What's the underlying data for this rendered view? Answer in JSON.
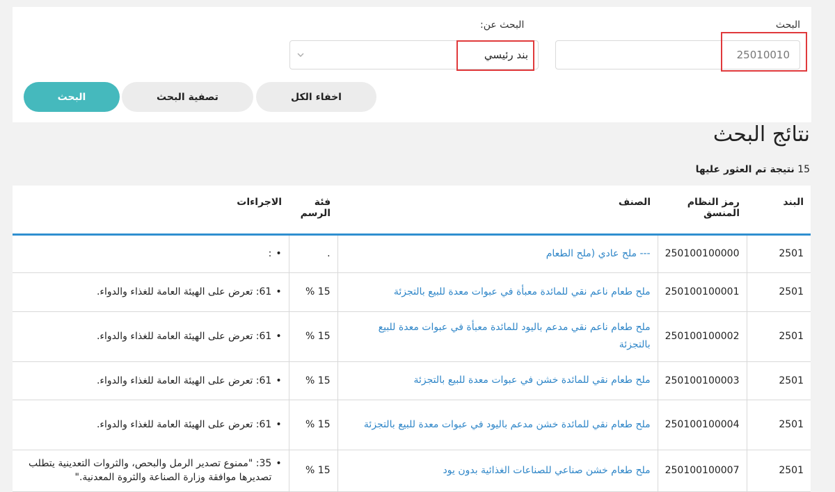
{
  "search": {
    "label": "البحث",
    "value": "25010010",
    "search_for_label": "البحث عن:",
    "search_for_value": "بند رئيسي",
    "hide_all_button": "اخفاء الكل",
    "filter_button": "تصفية البحث",
    "search_button": "البحث"
  },
  "results": {
    "title": "نتائج البحث",
    "count": "15",
    "count_text": "نتيجة تم العثور عليها",
    "headers": {
      "item": "البند",
      "hs_code": "رمز النظام المنسق",
      "classification": "الصنف",
      "fee": "فئة الرسم",
      "procedures": "الاجراءات"
    },
    "rows": [
      {
        "item": "2501",
        "hs_code": "250100100000",
        "classification": "--- ملح عادي (ملح الطعام",
        "fee": ".",
        "procedure": ":"
      },
      {
        "item": "2501",
        "hs_code": "250100100001",
        "classification": "ملح طعام ناعم نقي للمائدة معبأة في عبوات معدة للبيع بالتجزئة",
        "fee": "15 %",
        "procedure": "61: تعرض على الهيئة العامة للغذاء والدواء."
      },
      {
        "item": "2501",
        "hs_code": "250100100002",
        "classification": "ملح طعام ناعم نقي مدعم باليود للمائدة معبأة في عبوات معدة للبيع بالتجزئة",
        "fee": "15 %",
        "procedure": "61: تعرض على الهيئة العامة للغذاء والدواء."
      },
      {
        "item": "2501",
        "hs_code": "250100100003",
        "classification": "ملح طعام نقي للمائدة خشن في عبوات معدة للبيع بالتجزئة",
        "fee": "15 %",
        "procedure": "61: تعرض على الهيئة العامة للغذاء والدواء."
      },
      {
        "item": "2501",
        "hs_code": "250100100004",
        "classification": "ملح طعام نقي للمائدة خشن مدعم باليود في عبوات معدة للبيع بالتجزئة",
        "fee": "15 %",
        "procedure": "61: تعرض على الهيئة العامة للغذاء والدواء."
      },
      {
        "item": "2501",
        "hs_code": "250100100007",
        "classification": "ملح طعام خشن صناعي للصناعات الغذائية بدون يود",
        "fee": "15 %",
        "procedure": "35: \"ممنوع تصدير الرمل والبحص، والثروات التعدينية يتطلب تصديرها موافقة وزارة الصناعة والثروة المعدنية.\""
      }
    ]
  },
  "colors": {
    "accent": "#45b9bd",
    "link": "#2f86c8",
    "highlight": "#e0393b",
    "header_rule": "#2f8fd0"
  }
}
